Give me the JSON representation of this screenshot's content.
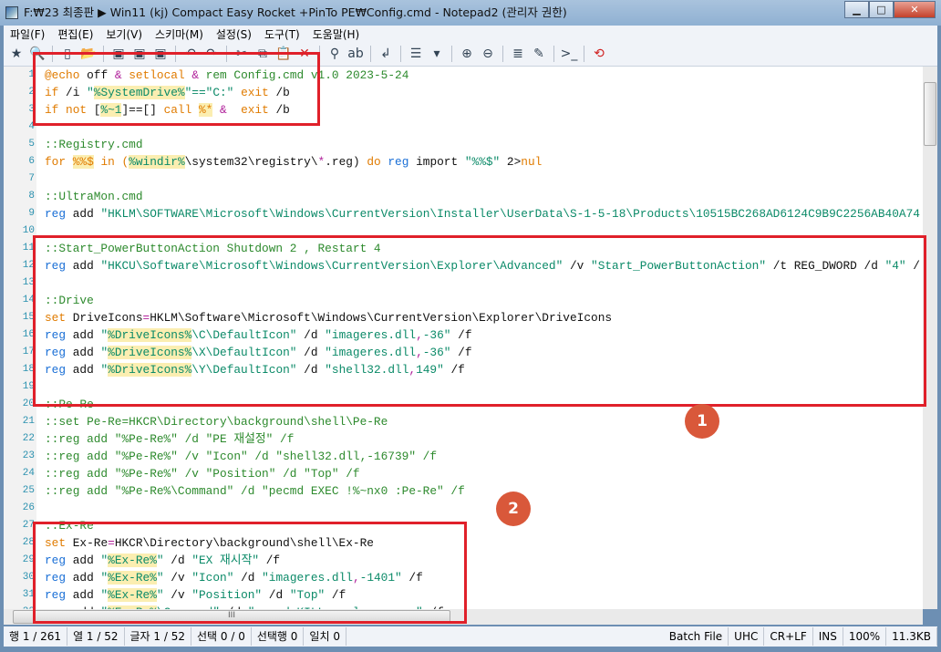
{
  "window": {
    "title": "F:₩23 최종판 ▶ Win11 (kj) Compact Easy Rocket +PinTo PE₩Config.cmd - Notepad2 (관리자 권한)",
    "minimize": "▁",
    "maximize": "□",
    "close": "✕"
  },
  "menu": [
    "파일(F)",
    "편집(E)",
    "보기(V)",
    "스키마(M)",
    "설정(S)",
    "도구(T)",
    "도움말(H)"
  ],
  "toolbar": [
    {
      "icon": "favorites-icon",
      "glyph": "★"
    },
    {
      "icon": "browse-icon",
      "glyph": "🔍"
    },
    "sep",
    {
      "icon": "new-file-icon",
      "glyph": "▯"
    },
    {
      "icon": "open-file-icon",
      "glyph": "📂"
    },
    "sep",
    {
      "icon": "save-icon",
      "glyph": "▣"
    },
    {
      "icon": "save-as-icon",
      "glyph": "▣"
    },
    {
      "icon": "save-copy-icon",
      "glyph": "▣"
    },
    "sep",
    {
      "icon": "undo-icon",
      "glyph": "↶"
    },
    {
      "icon": "redo-icon",
      "glyph": "↷"
    },
    "sep",
    {
      "icon": "cut-icon",
      "glyph": "✂"
    },
    {
      "icon": "copy-icon",
      "glyph": "⧉"
    },
    {
      "icon": "paste-icon",
      "glyph": "📋"
    },
    {
      "icon": "delete-icon",
      "glyph": "✕"
    },
    "sep",
    {
      "icon": "find-icon",
      "glyph": "⚲"
    },
    {
      "icon": "replace-icon",
      "glyph": "ab"
    },
    "sep",
    {
      "icon": "word-wrap-icon",
      "glyph": "↲"
    },
    "sep",
    {
      "icon": "scheme-icon",
      "glyph": "☰"
    },
    {
      "icon": "dropdown-icon",
      "glyph": "▾"
    },
    "sep",
    {
      "icon": "zoom-in-icon",
      "glyph": "⊕"
    },
    {
      "icon": "zoom-out-icon",
      "glyph": "⊖"
    },
    "sep",
    {
      "icon": "scheme-config-icon",
      "glyph": "≣"
    },
    {
      "icon": "edit-scheme-icon",
      "glyph": "✎"
    },
    "sep",
    {
      "icon": "console-icon",
      "glyph": ">_"
    },
    "sep",
    {
      "icon": "exit-icon",
      "glyph": "⟲"
    }
  ],
  "colors": {
    "keyword": "#e07b00",
    "command": "#1a6fd6",
    "string": "#0b8a68",
    "comment": "#2d8a2d",
    "operator": "#b0209a",
    "highlight": "#fbeeb1",
    "annotation": "#e0202a",
    "badge": "#d9583a"
  },
  "lines": [
    {
      "n": "1",
      "seg": [
        [
          "@echo",
          "kw"
        ],
        [
          " off ",
          "plain"
        ],
        [
          "&",
          "op"
        ],
        [
          " ",
          "plain"
        ],
        [
          "setlocal",
          "kw"
        ],
        [
          " ",
          "plain"
        ],
        [
          "&",
          "op"
        ],
        [
          " rem Config.cmd v1.0 2023-5-24",
          "cmt"
        ]
      ]
    },
    {
      "n": "2",
      "seg": [
        [
          "if",
          "kw"
        ],
        [
          " /i ",
          "plain"
        ],
        [
          "\"",
          "str"
        ],
        [
          "%SystemDrive%",
          "var"
        ],
        [
          "\"==\"C:\"",
          "str"
        ],
        [
          " ",
          "plain"
        ],
        [
          "exit",
          "kw"
        ],
        [
          " /b",
          "plain"
        ]
      ]
    },
    {
      "n": "3",
      "seg": [
        [
          "if not",
          "kw"
        ],
        [
          " [",
          "plain"
        ],
        [
          "%~1",
          "var"
        ],
        [
          "]==[] ",
          "plain"
        ],
        [
          "call",
          "kw"
        ],
        [
          " ",
          "plain"
        ],
        [
          "%*",
          "varo"
        ],
        [
          " ",
          "plain"
        ],
        [
          "&",
          "op"
        ],
        [
          "  ",
          "plain"
        ],
        [
          "exit",
          "kw"
        ],
        [
          " /b",
          "plain"
        ]
      ]
    },
    {
      "n": "4",
      "seg": []
    },
    {
      "n": "5",
      "seg": [
        [
          "::Registry.cmd",
          "cmt"
        ]
      ]
    },
    {
      "n": "6",
      "seg": [
        [
          "for",
          "kw"
        ],
        [
          " ",
          "plain"
        ],
        [
          "%%$",
          "varo"
        ],
        [
          " ",
          "plain"
        ],
        [
          "in",
          "kw"
        ],
        [
          " (",
          "kw"
        ],
        [
          "%windir%",
          "var"
        ],
        [
          "\\system32\\registry\\",
          "plain"
        ],
        [
          "*",
          "op"
        ],
        [
          ".reg) ",
          "plain"
        ],
        [
          "do",
          "kw"
        ],
        [
          " ",
          "plain"
        ],
        [
          "reg",
          "cmd"
        ],
        [
          " import ",
          "plain"
        ],
        [
          "\"%%$\"",
          "str"
        ],
        [
          " 2>",
          "plain"
        ],
        [
          "nul",
          "kw"
        ]
      ]
    },
    {
      "n": "7",
      "seg": []
    },
    {
      "n": "8",
      "seg": [
        [
          "::UltraMon.cmd",
          "cmt"
        ]
      ]
    },
    {
      "n": "9",
      "seg": [
        [
          "reg",
          "cmd"
        ],
        [
          " add ",
          "plain"
        ],
        [
          "\"HKLM\\SOFTWARE\\Microsoft\\Windows\\CurrentVersion\\Installer\\UserData\\S-1-5-18\\Products\\10515BC268AD6124C9B9C2256AB40A74",
          "str"
        ]
      ]
    },
    {
      "n": "10",
      "seg": []
    },
    {
      "n": "11",
      "seg": [
        [
          "::Start_PowerButtonAction Shutdown 2 , Restart 4",
          "cmt"
        ]
      ]
    },
    {
      "n": "12",
      "seg": [
        [
          "reg",
          "cmd"
        ],
        [
          " add ",
          "plain"
        ],
        [
          "\"HKCU\\Software\\Microsoft\\Windows\\CurrentVersion\\Explorer\\Advanced\"",
          "str"
        ],
        [
          " /v ",
          "plain"
        ],
        [
          "\"Start_PowerButtonAction\"",
          "str"
        ],
        [
          " /t REG_DWORD /d ",
          "plain"
        ],
        [
          "\"4\"",
          "str"
        ],
        [
          " /",
          "plain"
        ]
      ]
    },
    {
      "n": "13",
      "seg": []
    },
    {
      "n": "14",
      "seg": [
        [
          "::Drive",
          "cmt"
        ]
      ]
    },
    {
      "n": "15",
      "seg": [
        [
          "set",
          "kw"
        ],
        [
          " DriveIcons",
          "plain"
        ],
        [
          "=",
          "op"
        ],
        [
          "HKLM\\Software\\Microsoft\\Windows\\CurrentVersion\\Explorer\\DriveIcons",
          "plain"
        ]
      ]
    },
    {
      "n": "16",
      "seg": [
        [
          "reg",
          "cmd"
        ],
        [
          " add ",
          "plain"
        ],
        [
          "\"",
          "str"
        ],
        [
          "%DriveIcons%",
          "var"
        ],
        [
          "\\C\\DefaultIcon\"",
          "str"
        ],
        [
          " /d ",
          "plain"
        ],
        [
          "\"imageres.dll",
          "str"
        ],
        [
          ",",
          "op"
        ],
        [
          "-36\"",
          "str"
        ],
        [
          " /f",
          "plain"
        ]
      ]
    },
    {
      "n": "17",
      "seg": [
        [
          "reg",
          "cmd"
        ],
        [
          " add ",
          "plain"
        ],
        [
          "\"",
          "str"
        ],
        [
          "%DriveIcons%",
          "var"
        ],
        [
          "\\X\\DefaultIcon\"",
          "str"
        ],
        [
          " /d ",
          "plain"
        ],
        [
          "\"imageres.dll",
          "str"
        ],
        [
          ",",
          "op"
        ],
        [
          "-36\"",
          "str"
        ],
        [
          " /f",
          "plain"
        ]
      ]
    },
    {
      "n": "18",
      "seg": [
        [
          "reg",
          "cmd"
        ],
        [
          " add ",
          "plain"
        ],
        [
          "\"",
          "str"
        ],
        [
          "%DriveIcons%",
          "var"
        ],
        [
          "\\Y\\DefaultIcon\"",
          "str"
        ],
        [
          " /d ",
          "plain"
        ],
        [
          "\"shell32.dll",
          "str"
        ],
        [
          ",",
          "op"
        ],
        [
          "149\"",
          "str"
        ],
        [
          " /f",
          "plain"
        ]
      ]
    },
    {
      "n": "19",
      "seg": []
    },
    {
      "n": "20",
      "seg": [
        [
          "::Pe-Re",
          "cmt"
        ]
      ]
    },
    {
      "n": "21",
      "seg": [
        [
          "::set Pe-Re=HKCR\\Directory\\background\\shell\\Pe-Re",
          "cmt"
        ]
      ]
    },
    {
      "n": "22",
      "seg": [
        [
          "::reg add \"%Pe-Re%\" /d \"PE 재설정\" /f",
          "cmt"
        ]
      ]
    },
    {
      "n": "23",
      "seg": [
        [
          "::reg add \"%Pe-Re%\" /v \"Icon\" /d \"shell32.dll,-16739\" /f",
          "cmt"
        ]
      ]
    },
    {
      "n": "24",
      "seg": [
        [
          "::reg add \"%Pe-Re%\" /v \"Position\" /d \"Top\" /f",
          "cmt"
        ]
      ]
    },
    {
      "n": "25",
      "seg": [
        [
          "::reg add \"%Pe-Re%\\Command\" /d \"pecmd EXEC !%~nx0 :Pe-Re\" /f",
          "cmt"
        ]
      ]
    },
    {
      "n": "26",
      "seg": []
    },
    {
      "n": "27",
      "seg": [
        [
          "::Ex-Re",
          "cmt"
        ]
      ]
    },
    {
      "n": "28",
      "seg": [
        [
          "set",
          "kw"
        ],
        [
          " Ex-Re",
          "plain"
        ],
        [
          "=",
          "op"
        ],
        [
          "HKCR\\Directory\\background\\shell\\Ex-Re",
          "plain"
        ]
      ]
    },
    {
      "n": "29",
      "seg": [
        [
          "reg",
          "cmd"
        ],
        [
          " add ",
          "plain"
        ],
        [
          "\"",
          "str"
        ],
        [
          "%Ex-Re%",
          "var"
        ],
        [
          "\"",
          "str"
        ],
        [
          " /d ",
          "plain"
        ],
        [
          "\"EX 재시작\"",
          "str"
        ],
        [
          " /f",
          "plain"
        ]
      ]
    },
    {
      "n": "30",
      "seg": [
        [
          "reg",
          "cmd"
        ],
        [
          " add ",
          "plain"
        ],
        [
          "\"",
          "str"
        ],
        [
          "%Ex-Re%",
          "var"
        ],
        [
          "\"",
          "str"
        ],
        [
          " /v ",
          "plain"
        ],
        [
          "\"Icon\"",
          "str"
        ],
        [
          " /d ",
          "plain"
        ],
        [
          "\"imageres.dll",
          "str"
        ],
        [
          ",",
          "op"
        ],
        [
          "-1401\"",
          "str"
        ],
        [
          " /f",
          "plain"
        ]
      ]
    },
    {
      "n": "31",
      "seg": [
        [
          "reg",
          "cmd"
        ],
        [
          " add ",
          "plain"
        ],
        [
          "\"",
          "str"
        ],
        [
          "%Ex-Re%",
          "var"
        ],
        [
          "\"",
          "str"
        ],
        [
          " /v ",
          "plain"
        ],
        [
          "\"Position\"",
          "str"
        ],
        [
          " /d ",
          "plain"
        ],
        [
          "\"Top\"",
          "str"
        ],
        [
          " /f",
          "plain"
        ]
      ]
    },
    {
      "n": "32",
      "seg": [
        [
          "reg",
          "cmd"
        ],
        [
          " add ",
          "plain"
        ],
        [
          "\"",
          "str"
        ],
        [
          "%Ex-Re%",
          "var"
        ],
        [
          "\\Command\"",
          "str"
        ],
        [
          " /d ",
          "plain"
        ],
        [
          "\"pecmd KILL explorer.exe\"",
          "str"
        ],
        [
          " /f",
          "plain"
        ]
      ]
    }
  ],
  "status": {
    "line": "행 1 / 261",
    "col": "열 1 / 52",
    "char": "글자 1 / 52",
    "sel": "선택 0 / 0",
    "selLines": "선택행 0",
    "match": "일치 0",
    "lexer": "Batch File",
    "encoding": "UHC",
    "eol": "CR+LF",
    "mode": "INS",
    "zoom": "100%",
    "size": "11.3KB"
  },
  "annotations": {
    "badge1": "1",
    "badge2": "2"
  },
  "scroll": {
    "hthumb_grip": "III"
  }
}
